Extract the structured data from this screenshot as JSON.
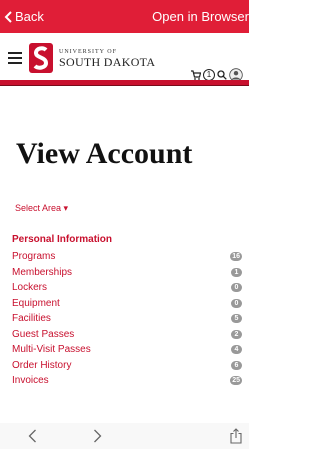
{
  "topbar": {
    "back_label": "Back",
    "open_label": "Open in Browser"
  },
  "header": {
    "logo_small": "UNIVERSITY OF",
    "logo_big": "SOUTH DAKOTA",
    "cart_count": "1"
  },
  "page": {
    "title": "View Account",
    "select_area": "Select Area ▾",
    "section_title": "Personal Information"
  },
  "menu": [
    {
      "label": "Programs",
      "count": "16"
    },
    {
      "label": "Memberships",
      "count": "1"
    },
    {
      "label": "Lockers",
      "count": "0"
    },
    {
      "label": "Equipment",
      "count": "0"
    },
    {
      "label": "Facilities",
      "count": "5"
    },
    {
      "label": "Guest Passes",
      "count": "2"
    },
    {
      "label": "Multi-Visit Passes",
      "count": "4"
    },
    {
      "label": "Order History",
      "count": "6"
    },
    {
      "label": "Invoices",
      "count": "25"
    }
  ],
  "colors": {
    "brand_red": "#e01e37",
    "link_red": "#c8102e",
    "badge_gray": "#999999"
  }
}
